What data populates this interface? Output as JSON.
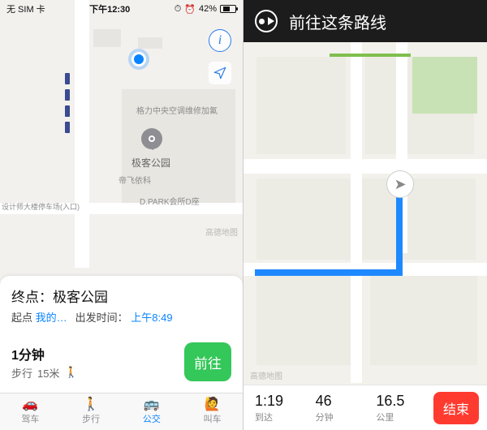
{
  "left": {
    "statusbar": {
      "carrier": "无 SIM 卡",
      "time": "下午12:30",
      "battery_pct": "42%"
    },
    "map": {
      "poi_pin_label": "极客公园",
      "labels": {
        "northLabel": "格力中央空调维修加氟",
        "south1": "帝飞依科",
        "south2": "D.PARK会所D座",
        "westEntrance": "设计师大楼停车场(入口)"
      },
      "watermark": "高德地图",
      "info_glyph": "i"
    },
    "card": {
      "destination_prefix": "终点：",
      "destination": "极客公园",
      "origin_label": "起点",
      "origin_value": "我的…",
      "depart_label": "出发时间：",
      "depart_value": "上午8:49",
      "eta_main": "1分钟",
      "eta_sub_prefix": "步行",
      "eta_sub_value": "15米",
      "go_label": "前往"
    },
    "tabs": [
      {
        "icon": "🚗",
        "label": "驾车",
        "name": "tab-drive"
      },
      {
        "icon": "🚶",
        "label": "步行",
        "name": "tab-walk"
      },
      {
        "icon": "🚌",
        "label": "公交",
        "name": "tab-transit"
      },
      {
        "icon": "🙋",
        "label": "叫车",
        "name": "tab-ride"
      }
    ],
    "active_tab_index": 2
  },
  "right": {
    "banner_text": "前往这条路线",
    "watermark": "高德地图",
    "nav_glyph": "➤",
    "metrics": {
      "arrival_value": "1:19",
      "arrival_label": "到达",
      "duration_value": "46",
      "duration_label": "分钟",
      "distance_value": "16.5",
      "distance_label": "公里"
    },
    "end_label": "结束"
  }
}
